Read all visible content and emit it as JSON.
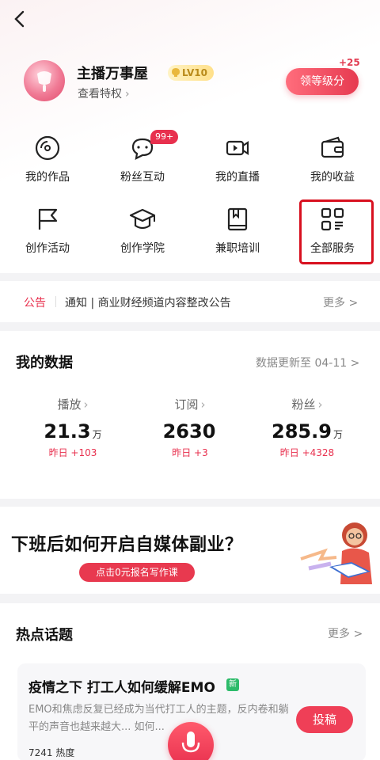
{
  "header": {
    "nickname": "主播万事屋",
    "level": "LV10",
    "privilege": "查看特权",
    "claim_button": "领等级分",
    "claim_bonus": "+25"
  },
  "grid": [
    {
      "label": "我的作品",
      "icon": "disc-icon"
    },
    {
      "label": "粉丝互动",
      "icon": "chat-icon",
      "badge": "99+"
    },
    {
      "label": "我的直播",
      "icon": "video-icon"
    },
    {
      "label": "我的收益",
      "icon": "wallet-icon"
    },
    {
      "label": "创作活动",
      "icon": "flag-icon"
    },
    {
      "label": "创作学院",
      "icon": "graduation-cap-icon"
    },
    {
      "label": "兼职培训",
      "icon": "book-icon"
    },
    {
      "label": "全部服务",
      "icon": "grid-icon"
    }
  ],
  "notice": {
    "tag": "公告",
    "text": "通知 | 商业财经频道内容整改公告",
    "more": "更多 >"
  },
  "my_data": {
    "title": "我的数据",
    "update": "数据更新至 04-11 >",
    "stats": [
      {
        "name": "播放",
        "value": "21.3",
        "unit": "万",
        "delta": "昨日 +103"
      },
      {
        "name": "订阅",
        "value": "2630",
        "unit": "",
        "delta": "昨日 +3"
      },
      {
        "name": "粉丝",
        "value": "285.9",
        "unit": "万",
        "delta": "昨日 +4328"
      }
    ]
  },
  "banner": {
    "headline": "下班后如何开启自媒体副业？",
    "cta": "点击0元报名写作课"
  },
  "hot_topics": {
    "title": "热点话题",
    "more": "更多 >",
    "card": {
      "title": "疫情之下 打工人如何缓解EMO",
      "tag": "新",
      "desc": "EMO和焦虑反复已经成为当代打工人的主题，反内卷和躺平的声音也越来越大... 如何...",
      "post_button": "投稿",
      "heat": "7241 热度"
    }
  },
  "colors": {
    "accent": "#e8304e",
    "highlight": "#d8101f"
  }
}
